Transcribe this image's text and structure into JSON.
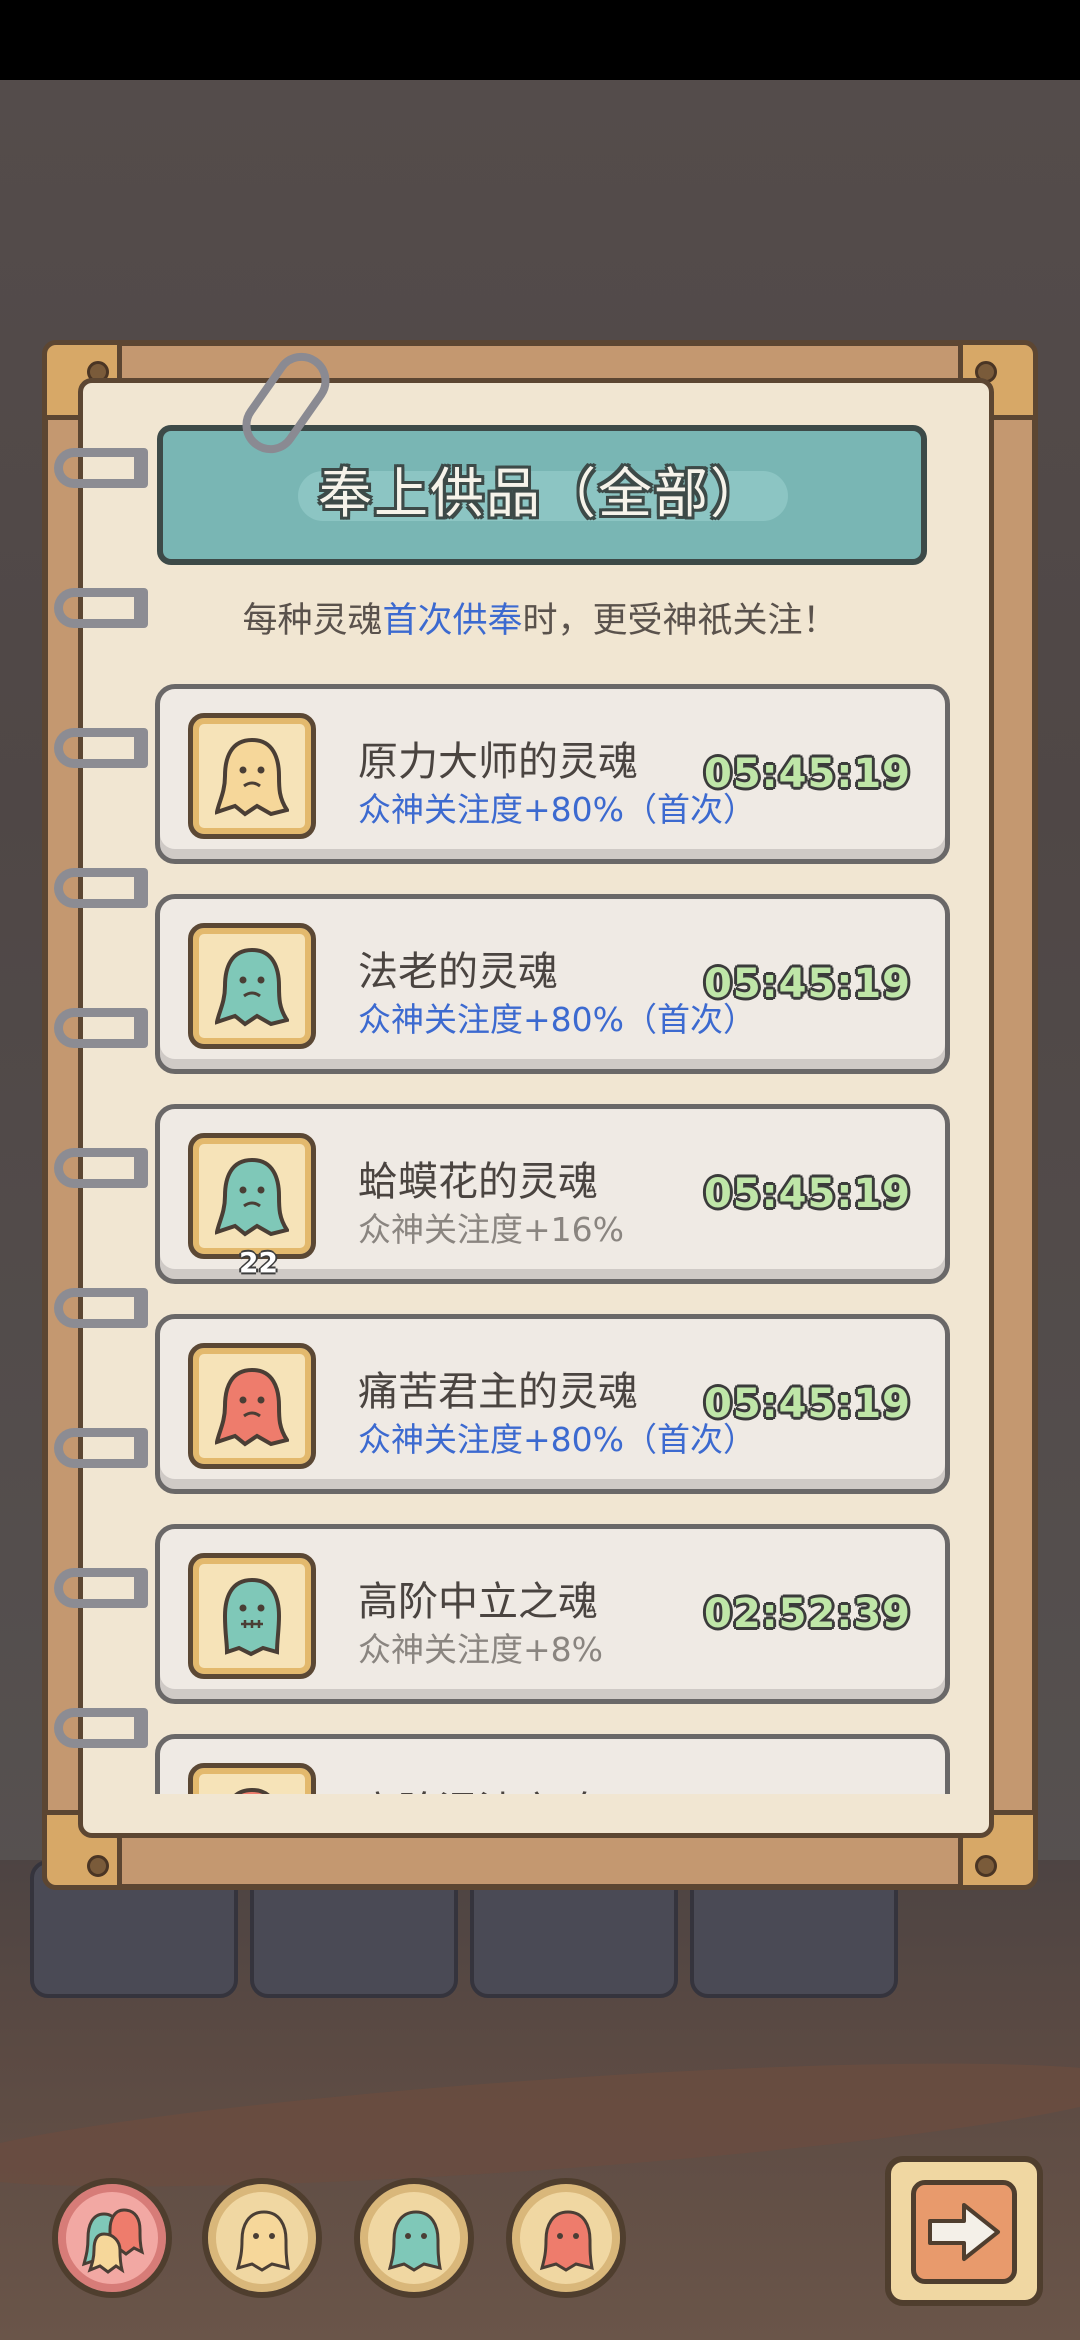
{
  "title": "奉上供品（全部）",
  "subtitle": {
    "before": "每种灵魂",
    "highlight": "首次供奉",
    "after": "时，更受神祇关注！"
  },
  "colors": {
    "highlight": "#3c6ad0",
    "banner": "#79b6b4",
    "timer": "#bfe6a8"
  },
  "offerings": [
    {
      "name": "原力大师的灵魂",
      "attention": "众神关注度+80%（首次）",
      "timer": "05:45:19",
      "ghost_color": "#f6d79a",
      "first": true,
      "count": ""
    },
    {
      "name": "法老的灵魂",
      "attention": "众神关注度+80%（首次）",
      "timer": "05:45:19",
      "ghost_color": "#7fc8b8",
      "first": true,
      "count": ""
    },
    {
      "name": "蛤蟆花的灵魂",
      "attention": "众神关注度+16%",
      "timer": "05:45:19",
      "ghost_color": "#7fc8b8",
      "first": false,
      "count": "22"
    },
    {
      "name": "痛苦君主的灵魂",
      "attention": "众神关注度+80%（首次）",
      "timer": "05:45:19",
      "ghost_color": "#ee7c6c",
      "first": true,
      "count": ""
    },
    {
      "name": "高阶中立之魂",
      "attention": "众神关注度+8%",
      "timer": "02:52:39",
      "ghost_color": "#7fc8b8",
      "first": false,
      "count": ""
    },
    {
      "name": "高阶混沌之魂",
      "attention": "",
      "timer": "",
      "ghost_color": "#ee7c6c",
      "first": false,
      "count": ""
    }
  ],
  "filter_tabs": [
    {
      "icon": "all-souls-icon",
      "active": true
    },
    {
      "icon": "yellow-ghost-icon",
      "active": false
    },
    {
      "icon": "green-ghost-icon",
      "active": false
    },
    {
      "icon": "red-ghost-icon",
      "active": false
    }
  ],
  "next_button_icon": "arrow-right-icon"
}
